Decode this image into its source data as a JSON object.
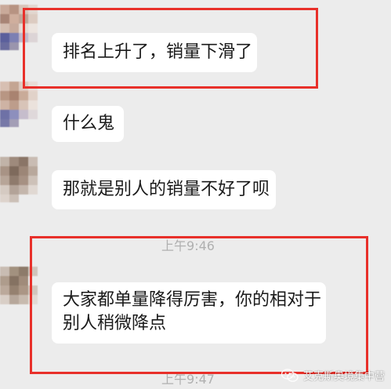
{
  "chat": {
    "messages": [
      {
        "text": "排名上升了，销量下滑了"
      },
      {
        "text": "什么鬼"
      },
      {
        "text": "那就是别人的销量不好了呗"
      },
      {
        "line1": "大家都单量降得厉害，你的相对于",
        "line2": "别人稍微降点"
      }
    ],
    "timestamps": [
      "上午9:46",
      "上午9:47"
    ]
  },
  "watermark": {
    "text": "艾克斯奥境集中营",
    "icon": "wechat-icon"
  },
  "colors": {
    "background": "#ececec",
    "bubble": "#ffffff",
    "highlight": "#e8302a"
  }
}
